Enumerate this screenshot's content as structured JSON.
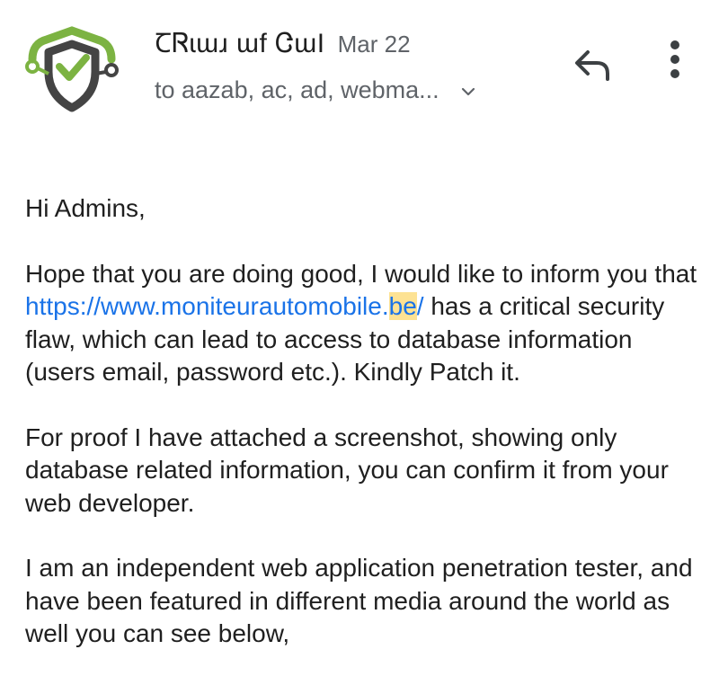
{
  "header": {
    "sender": "ꞆᏒɩɯɹ ɯf ᏣɯI",
    "date": "Mar 22",
    "recipients": "to aazab, ac, ad, webma...",
    "reply_icon": "reply-icon",
    "more_icon": "more-vert-icon",
    "expand_icon": "chevron-down-icon",
    "avatar_icon": "shield-check-icon"
  },
  "colors": {
    "link": "#1a73e8",
    "highlight": "#fde293",
    "avatar_green": "#7cb342",
    "avatar_dark": "#444444"
  },
  "body": {
    "greeting": "Hi Admins,",
    "p1_before": "Hope that you are doing good, I would like to inform you that ",
    "p1_link_a": "https://www.moniteurautomobile.",
    "p1_link_b": "be",
    "p1_link_c": "/",
    "p1_after": " has a critical security flaw, which can lead to access to database information (users email, password etc.). Kindly Patch it.",
    "p2": "For proof I have attached a screenshot, showing only database related information, you can confirm it from your web developer.",
    "p3": "I am an independent web application penetration tester, and have been featured in different media around the world as well you can see below,"
  }
}
